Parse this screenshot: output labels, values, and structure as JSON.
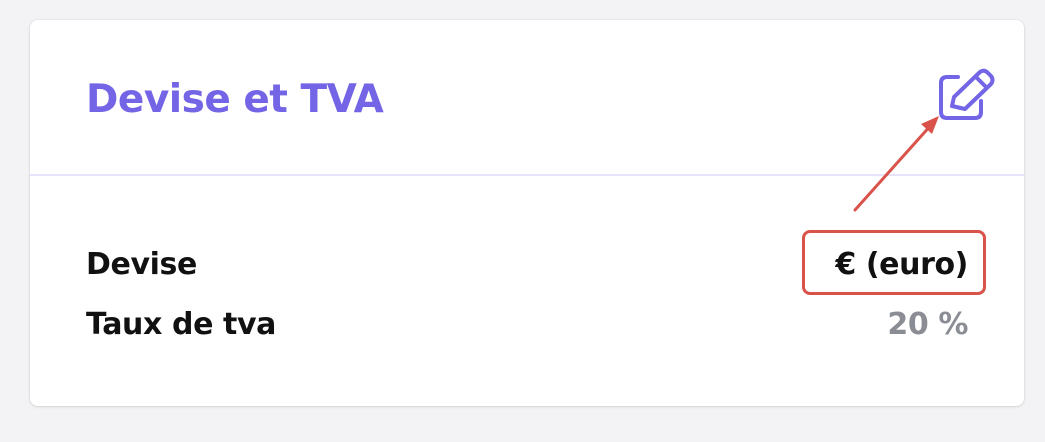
{
  "card": {
    "title": "Devise et TVA",
    "edit_icon": "edit-pencil-square-icon",
    "rows": [
      {
        "label": "Devise",
        "value": "€ (euro)"
      },
      {
        "label": "Taux de tva",
        "value": "20 %"
      }
    ]
  },
  "colors": {
    "accent": "#7365e6",
    "divider": "#e6e3fb",
    "annotation": "#d9534a",
    "muted_value": "#8a8d93"
  }
}
